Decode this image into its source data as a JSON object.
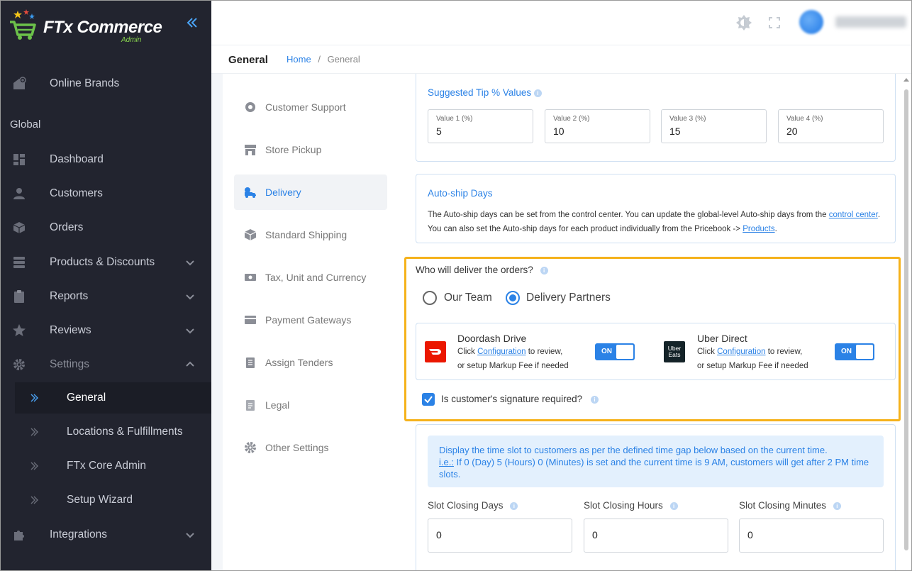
{
  "app": {
    "brand": "FTx Commerce",
    "sub": "Admin"
  },
  "sidebar": {
    "top_item": "Online Brands",
    "section": "Global",
    "items": [
      {
        "label": "Dashboard",
        "icon": "dashboard-icon"
      },
      {
        "label": "Customers",
        "icon": "user-icon"
      },
      {
        "label": "Orders",
        "icon": "box-icon"
      },
      {
        "label": "Products & Discounts",
        "icon": "server-icon"
      },
      {
        "label": "Reports",
        "icon": "clipboard-icon"
      },
      {
        "label": "Reviews",
        "icon": "star-icon"
      },
      {
        "label": "Settings",
        "icon": "gear-icon"
      }
    ],
    "settings_sub": [
      "General",
      "Locations & Fulfillments",
      "FTx Core Admin",
      "Setup Wizard"
    ],
    "integrations": "Integrations"
  },
  "breadcrumb": {
    "title": "General",
    "home": "Home",
    "separator": "/",
    "current": "General"
  },
  "settings_menu": [
    "Customer Support",
    "Store Pickup",
    "Delivery",
    "Standard Shipping",
    "Tax, Unit and Currency",
    "Payment Gateways",
    "Assign Tenders",
    "Legal",
    "Other Settings"
  ],
  "tip": {
    "title": "Suggested Tip % Values",
    "values": [
      {
        "caption": "Value 1 (%)",
        "value": "5"
      },
      {
        "caption": "Value 2 (%)",
        "value": "10"
      },
      {
        "caption": "Value 3 (%)",
        "value": "15"
      },
      {
        "caption": "Value 4 (%)",
        "value": "20"
      }
    ]
  },
  "autoship": {
    "title": "Auto-ship Days",
    "text_1": "The Auto-ship days can be set from the control center. You can update the global-level Auto-ship days from the",
    "link_1": "control center",
    "text_2": ". You can also set the Auto-ship days for each product individually from the Pricebook ->",
    "link_2": "Products",
    "text_3": "."
  },
  "delivery": {
    "question": "Who will deliver the orders?",
    "option_1": "Our Team",
    "option_2": "Delivery Partners",
    "selected": "Delivery Partners",
    "partners": [
      {
        "name": "Doordash Drive",
        "click": "Click",
        "link": "Configuration",
        "desc_1": "to review,",
        "desc_2": "or setup Markup Fee if needed",
        "toggle": "ON"
      },
      {
        "name": "Uber Direct",
        "click": "Click",
        "link": "Configuration",
        "desc_1": "to review,",
        "desc_2": "or setup Markup Fee if needed",
        "toggle": "ON"
      }
    ],
    "uber_logo": "Uber Eats",
    "signature": "Is customer's signature required?",
    "signature_checked": true
  },
  "timeslot": {
    "note_line_1": "Display the time slot to customers as per the defined time gap below based on the current time.",
    "note_ie": "i.e.:",
    "note_line_2": " If 0 (Day) 5 (Hours) 0 (Minutes) is set and the current time is 9 AM, customers will get after 2 PM time slots.",
    "fields": [
      {
        "label": "Slot Closing Days",
        "value": "0"
      },
      {
        "label": "Slot Closing Hours",
        "value": "0"
      },
      {
        "label": "Slot Closing Minutes",
        "value": "0"
      }
    ]
  },
  "colors": {
    "sidebar_bg": "#22242f",
    "accent": "#2b82e6",
    "highlight": "#f5b21b",
    "doordash": "#eb1700",
    "uber": "#142328"
  }
}
